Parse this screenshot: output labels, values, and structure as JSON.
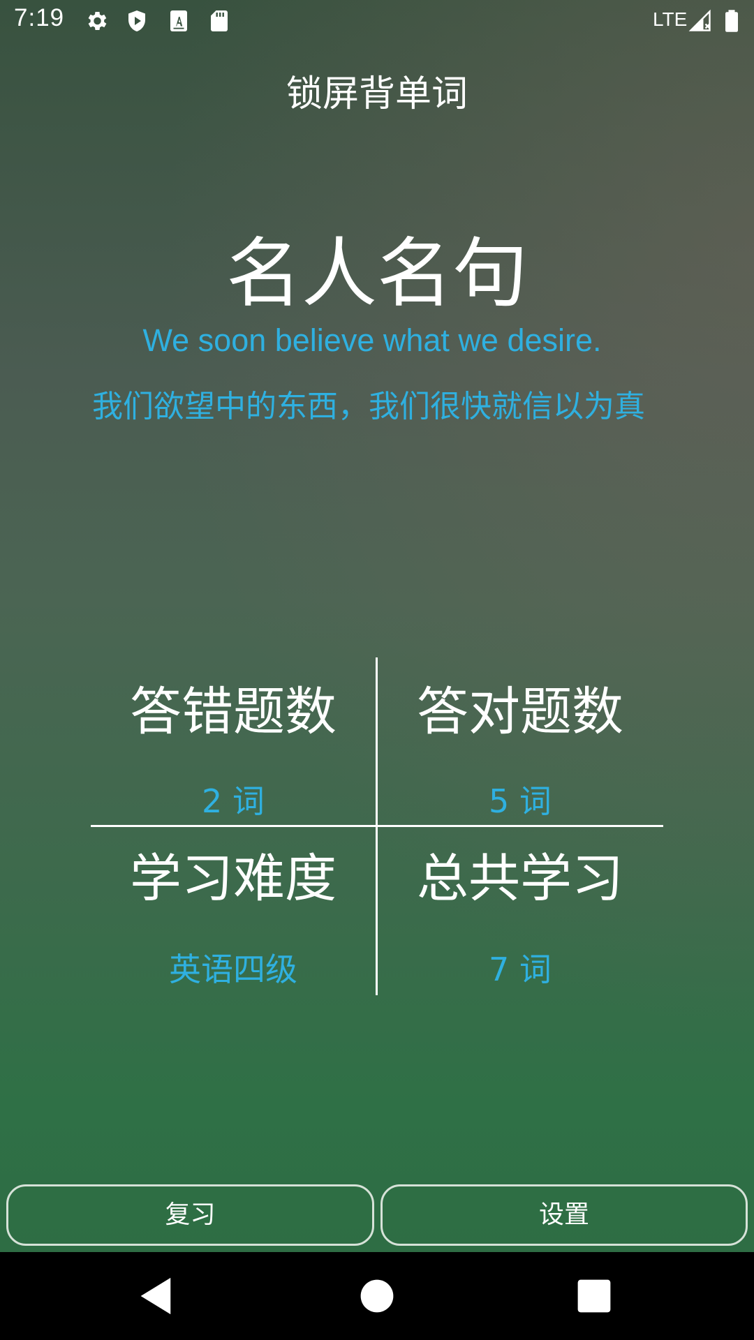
{
  "status_bar": {
    "time": "7:19",
    "network": "LTE",
    "icons": [
      "gear-icon",
      "shield-play-icon",
      "text-a-icon",
      "sd-card-icon",
      "signal-icon",
      "battery-icon"
    ]
  },
  "app": {
    "title": "锁屏背单词"
  },
  "quote": {
    "heading": "名人名句",
    "english": "We soon believe what we desire.",
    "chinese": "我们欲望中的东西，我们很快就信以为真"
  },
  "stats": {
    "wrong": {
      "label": "答错题数",
      "value": "2 词"
    },
    "correct": {
      "label": "答对题数",
      "value": "5 词"
    },
    "difficulty": {
      "label": "学习难度",
      "value": "英语四级"
    },
    "total": {
      "label": "总共学习",
      "value": "7 词"
    }
  },
  "buttons": {
    "review": "复习",
    "settings": "设置"
  },
  "colors": {
    "accent": "#2fb0e0",
    "text": "#ffffff",
    "nav_bar": "#000000"
  }
}
